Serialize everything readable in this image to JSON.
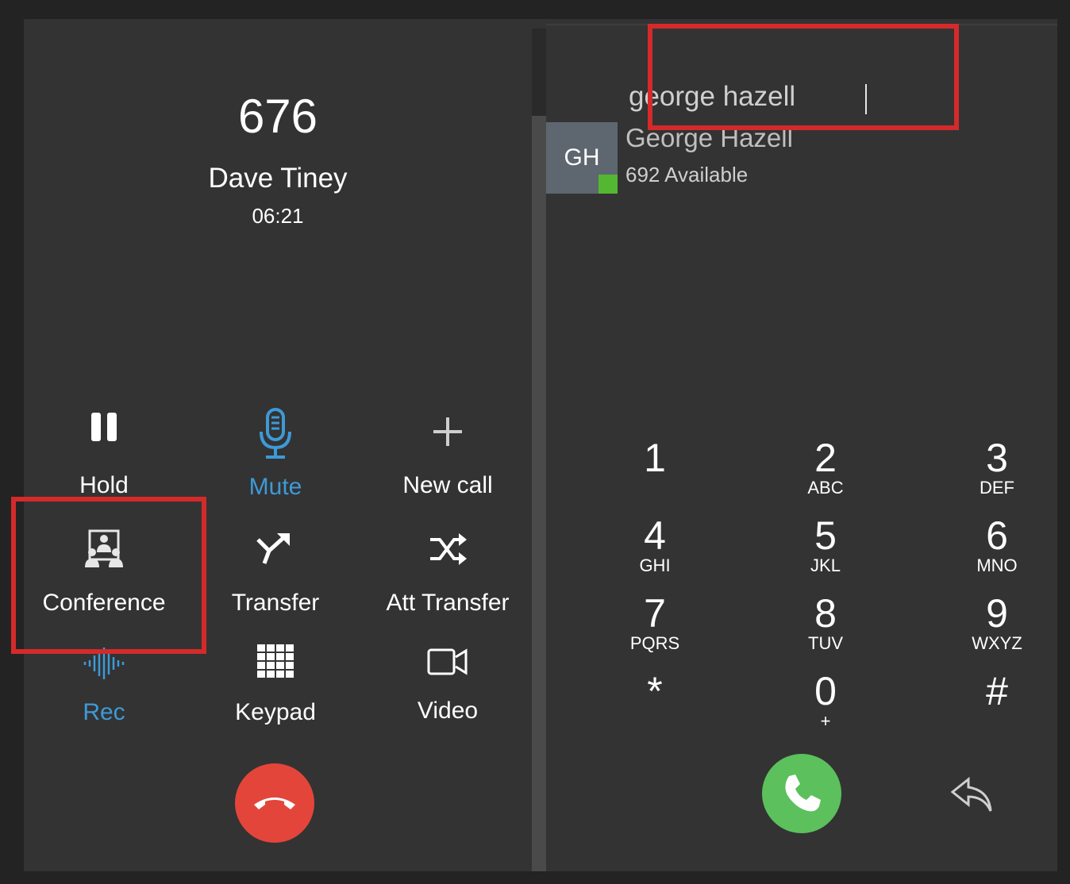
{
  "call": {
    "number": "676",
    "name": "Dave Tiney",
    "timer": "06:21"
  },
  "actions": {
    "hold": "Hold",
    "mute": "Mute",
    "new_call": "New call",
    "conference": "Conference",
    "transfer": "Transfer",
    "att_transfer": "Att Transfer",
    "rec": "Rec",
    "keypad": "Keypad",
    "video": "Video"
  },
  "search": {
    "value": "george hazell"
  },
  "contact": {
    "initials": "GH",
    "name": "George Hazell",
    "status": "692 Available",
    "presence_color": "#53b733"
  },
  "keypad": [
    {
      "digit": "1",
      "letters": ""
    },
    {
      "digit": "2",
      "letters": "ABC"
    },
    {
      "digit": "3",
      "letters": "DEF"
    },
    {
      "digit": "4",
      "letters": "GHI"
    },
    {
      "digit": "5",
      "letters": "JKL"
    },
    {
      "digit": "6",
      "letters": "MNO"
    },
    {
      "digit": "7",
      "letters": "PQRS"
    },
    {
      "digit": "8",
      "letters": "TUV"
    },
    {
      "digit": "9",
      "letters": "WXYZ"
    },
    {
      "digit": "*",
      "letters": ""
    },
    {
      "digit": "0",
      "letters": "+"
    },
    {
      "digit": "#",
      "letters": ""
    }
  ],
  "colors": {
    "accent_blue": "#3d9ad8",
    "hangup_red": "#e4453a",
    "call_green": "#5cc05c",
    "highlight_red": "#d42a2a"
  }
}
